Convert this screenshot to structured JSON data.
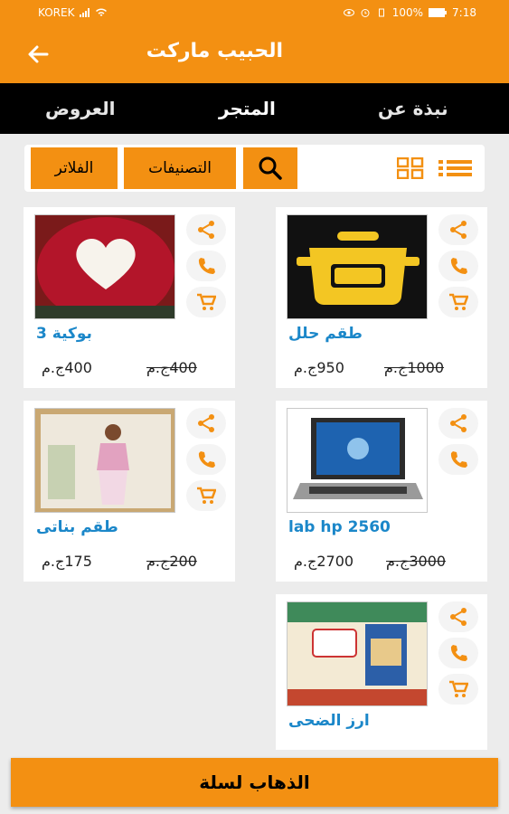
{
  "status_bar": {
    "carrier": "KOREK",
    "battery": "100%",
    "time": "7:18"
  },
  "app_bar": {
    "title": "الحبيب ماركت",
    "back_icon": "arrow-left-icon"
  },
  "tabs": {
    "offers": "العروض",
    "store": "المتجر",
    "about": "نبذة عن"
  },
  "toolbar": {
    "filters": "الفلاتر",
    "categories": "التصنيفات",
    "search_icon": "search-icon",
    "grid_icon": "grid-view-icon",
    "list_icon": "list-view-icon"
  },
  "products": [
    {
      "name": "طقم حلل",
      "price": "950ج.م",
      "old_price": "1000ج.م"
    },
    {
      "name": "بوكية 3",
      "price": "400ج.م",
      "old_price": "400ج.م"
    },
    {
      "name": "lab hp 2560",
      "price": "2700ج.م",
      "old_price": "3000ج.م"
    },
    {
      "name": "طقم بناتى",
      "price": "175ج.م",
      "old_price": "200ج.م"
    },
    {
      "name": "ارز الضحى",
      "price": "",
      "old_price": ""
    }
  ],
  "colors": {
    "accent": "#f39012",
    "tab_bar": "#000000",
    "link": "#1b87c9"
  },
  "go_to_cart": "الذهاب لسلة"
}
